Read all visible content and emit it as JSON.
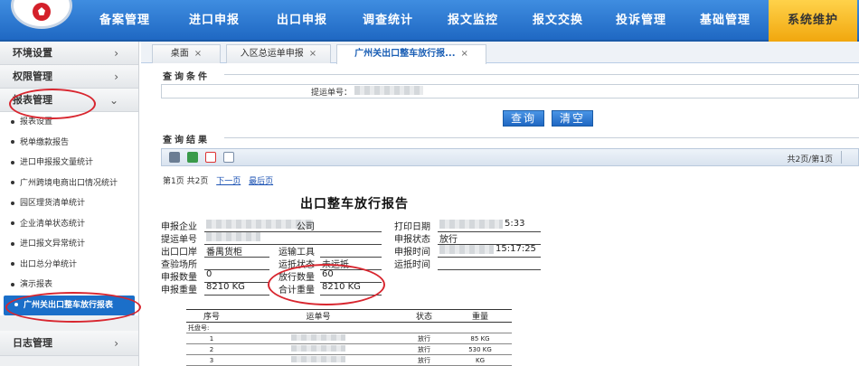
{
  "header": {
    "nav": [
      {
        "label": "备案管理",
        "active": false
      },
      {
        "label": "进口申报",
        "active": false
      },
      {
        "label": "出口申报",
        "active": false
      },
      {
        "label": "调查统计",
        "active": false
      },
      {
        "label": "报文监控",
        "active": false
      },
      {
        "label": "报文交换",
        "active": false
      },
      {
        "label": "投诉管理",
        "active": false
      },
      {
        "label": "基础管理",
        "active": false
      },
      {
        "label": "系统维护",
        "active": true
      }
    ]
  },
  "sidebar": {
    "groups": [
      {
        "label": "环境设置",
        "chevron": "›"
      },
      {
        "label": "权限管理",
        "chevron": "›"
      },
      {
        "label": "报表管理",
        "chevron": "⌄"
      }
    ],
    "items": [
      "报表设置",
      "税单缴款报告",
      "进口申报报文量统计",
      "广州跨境电商出口情况统计",
      "园区理货清单统计",
      "企业清单状态统计",
      "进口报文异常统计",
      "出口总分单统计",
      "演示报表",
      "广州关出口整车放行报表"
    ],
    "active_index": 9,
    "bottom_group": {
      "label": "日志管理",
      "chevron": "›"
    }
  },
  "tabs": [
    {
      "label": "桌面",
      "close": "×"
    },
    {
      "label": "入区总运单申报",
      "close": "×"
    },
    {
      "label": "广州关出口整车放行报...",
      "close": "×",
      "active": true
    }
  ],
  "query": {
    "section_title": "查询条件",
    "field_label": "提运单号：",
    "search_button": "查询",
    "clear_button": "清空"
  },
  "results": {
    "section_title": "查询结果",
    "pager": "共2页/第1页",
    "page_info": "第1页  共2页",
    "next_link": "下一页",
    "last_link": "最后页"
  },
  "report": {
    "title": "出口整车放行报告",
    "fields": {
      "company_label": "申报企业",
      "company_value": "公司",
      "print_date_label": "打印日期",
      "print_date_value": "5:33",
      "bill_label": "提运单号",
      "status_label": "申报状态",
      "status_value": "放行",
      "port_label": "出口口岸",
      "port_value": "番禺货柜",
      "transport_label": "运输工具",
      "apply_time_label": "申报时间",
      "apply_time_value": "15:17:25",
      "inspection_label": "查验场所",
      "arrival_status_label": "运抵状态",
      "arrival_status_value": "未运抵",
      "arrival_time_label": "运抵时间",
      "declared_qty_label": "申报数量",
      "declared_qty_value": "0",
      "release_qty_label": "放行数量",
      "release_qty_value": "60",
      "declared_weight_label": "申报重量",
      "declared_weight_value": "8210 KG",
      "total_weight_label": "合计重量",
      "total_weight_value": "8210 KG"
    },
    "table": {
      "headers": [
        "序号",
        "运单号",
        "状态",
        "重量"
      ],
      "group_row": "托盘号:",
      "rows": [
        {
          "no": "1",
          "status": "放行",
          "weight": "85",
          "unit": "KG"
        },
        {
          "no": "2",
          "status": "放行",
          "weight": "530",
          "unit": "KG"
        },
        {
          "no": "3",
          "status": "放行",
          "weight": "",
          "unit": "KG"
        }
      ]
    }
  },
  "colors": {
    "nav_bg": "#2a78d6",
    "nav_active": "#f5b41c",
    "sidebar_active": "#1b6fc9",
    "annotation_circle": "#d8262f"
  }
}
